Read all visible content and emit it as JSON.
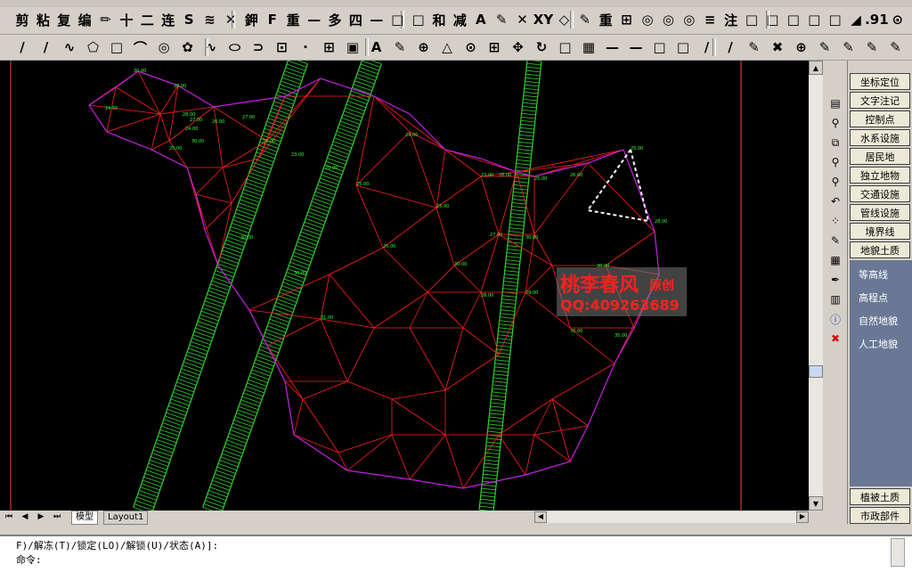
{
  "toolbar1": {
    "items": [
      "剪",
      "粘",
      "复",
      "编",
      "✏",
      "十",
      "二",
      "连",
      "S",
      "≋",
      "✕",
      "鉀",
      "F",
      "重",
      "—",
      "多",
      "四",
      "—",
      "□",
      "□",
      "和",
      "减",
      "A",
      "✎",
      "✕",
      "XY",
      "◇",
      "✎",
      "重",
      "⊞",
      "◎",
      "◎",
      "◎",
      "≡",
      "注",
      "□",
      "□",
      "□",
      "□",
      "□",
      "◢",
      ".91",
      "⊙"
    ]
  },
  "toolbar2": {
    "items": [
      "/",
      "/",
      "∿",
      "⬠",
      "□",
      "⌒",
      "◎",
      "✿",
      "∿",
      "⬭",
      "⊃",
      "⊡",
      "·",
      "⊞",
      "▣",
      "A",
      "✎",
      "⊕",
      "△",
      "⊙",
      "⊞",
      "✥",
      "↻",
      "□",
      "▦",
      "—",
      "—",
      "□",
      "□",
      "∕",
      "∕",
      "✎",
      "✖",
      "⊕",
      "✎",
      "✎",
      "✎",
      "✎"
    ]
  },
  "side_panel": {
    "buttons": [
      "坐标定位",
      "文字注记",
      "控制点",
      "水系设施",
      "居民地",
      "独立地物",
      "交通设施",
      "管线设施",
      "境界线",
      "地貌土质"
    ],
    "list_items": [
      "等高线",
      "高程点",
      "自然地貌",
      "人工地貌"
    ],
    "bottom_buttons": [
      "植被土质",
      "市政部件"
    ]
  },
  "tabs": {
    "model": "模型",
    "layout": "Layout1"
  },
  "command": {
    "line1": "F)/解冻(T)/锁定(LO)/解锁(U)/状态(A)]:",
    "line2": "命令:"
  },
  "watermark": {
    "title": "桃李春风",
    "title_suffix": "原创",
    "qq": "QQ:409263689"
  },
  "drawing": {
    "elevation_labels": [
      "30.00",
      "28.00",
      "24.50",
      "28.00",
      "27.00",
      "24.00",
      "30.00",
      "25.00",
      "26.00",
      "27.00",
      "28.00",
      "23.00",
      "29.00",
      "25.00",
      "24.00",
      "25.00",
      "23.00",
      "26.00",
      "25.00",
      "26.00",
      "25.00",
      "28.00",
      "30.00",
      "27.00",
      "25.00",
      "30.00",
      "29.00",
      "28.00",
      "30.00",
      "35.00",
      "30.00",
      "31.00",
      "30.00",
      "30.00"
    ],
    "colors": {
      "tin": "#ff2020",
      "boundary": "#c020e0",
      "road": "#30d030",
      "labels": "#30ff30",
      "selection": "#ffffff"
    }
  }
}
